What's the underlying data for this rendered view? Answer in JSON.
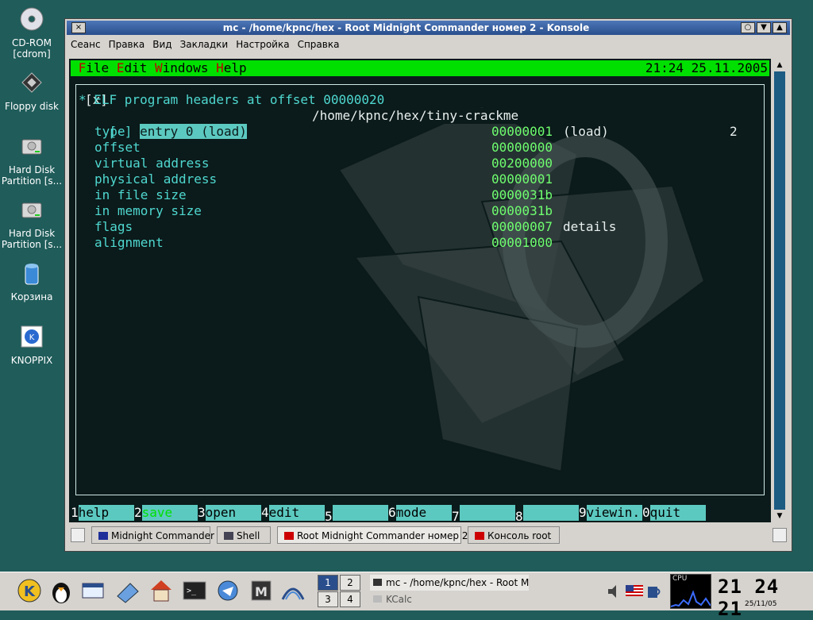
{
  "desktop": {
    "icons": [
      {
        "label_1": "CD-ROM",
        "label_2": "[cdrom]",
        "icon": "cdrom-icon"
      },
      {
        "label_1": "Floppy disk",
        "label_2": "",
        "icon": "floppy-icon"
      },
      {
        "label_1": "Hard Disk",
        "label_2": "Partition [s...",
        "icon": "harddisk-icon"
      },
      {
        "label_1": "Hard Disk",
        "label_2": "Partition [s...",
        "icon": "harddisk-icon"
      },
      {
        "label_1": "Корзина",
        "label_2": "",
        "icon": "trash-icon"
      },
      {
        "label_1": "KNOPPIX",
        "label_2": "",
        "icon": "knoppix-icon"
      }
    ]
  },
  "window": {
    "title": "mc - /home/kpnc/hex - Root Midnight Commander номер 2 - Konsole",
    "menu": [
      "Сеанс",
      "Правка",
      "Вид",
      "Закладки",
      "Настройка",
      "Справка"
    ],
    "close_glyph": "×",
    "btns": [
      "○",
      "▼",
      "▲"
    ],
    "tabs": [
      "Midnight Commander",
      "Shell",
      "Root Midnight Commander номер 2",
      "Консоль root"
    ]
  },
  "mc": {
    "menu": [
      {
        "hk": "F",
        "rest": "ile"
      },
      {
        "hk": "E",
        "rest": "dit"
      },
      {
        "hk": "W",
        "rest": "indows"
      },
      {
        "hk": "H",
        "rest": "elp"
      }
    ],
    "clock": "21:24 25.11.2005",
    "close_marker": "[x]",
    "path": "/home/kpnc/hex/tiny-crackme",
    "window_num": "2",
    "header": "* ELF program headers at offset 00000020",
    "entry_toggle": "[-]",
    "entry_label": "entry 0 (load)",
    "fields": [
      {
        "name": "type",
        "value": "00000001",
        "extra": "(load)"
      },
      {
        "name": "offset",
        "value": "00000000",
        "extra": ""
      },
      {
        "name": "virtual address",
        "value": "00200000",
        "extra": ""
      },
      {
        "name": "physical address",
        "value": "00000001",
        "extra": ""
      },
      {
        "name": "in file size",
        "value": "0000031b",
        "extra": ""
      },
      {
        "name": "in memory size",
        "value": "0000031b",
        "extra": ""
      },
      {
        "name": "flags",
        "value": "00000007",
        "extra": "details"
      },
      {
        "name": "alignment",
        "value": "00001000",
        "extra": ""
      }
    ],
    "fkeys": [
      {
        "n": "1",
        "label": "help"
      },
      {
        "n": "2",
        "label": "save"
      },
      {
        "n": "3",
        "label": "open"
      },
      {
        "n": "4",
        "label": "edit"
      },
      {
        "n": "5",
        "label": ""
      },
      {
        "n": "6",
        "label": "mode"
      },
      {
        "n": "7",
        "label": ""
      },
      {
        "n": "8",
        "label": ""
      },
      {
        "n": "9",
        "label": "viewin."
      },
      {
        "n": "0",
        "label": "quit"
      }
    ]
  },
  "taskbar": {
    "pager": [
      "1",
      "2",
      "3",
      "4"
    ],
    "tasks": [
      "mc - /home/kpnc/hex - Root M",
      "KCalc"
    ],
    "clock": "21 24 21",
    "date": "25/11/05",
    "cpu_label": "CPU"
  }
}
